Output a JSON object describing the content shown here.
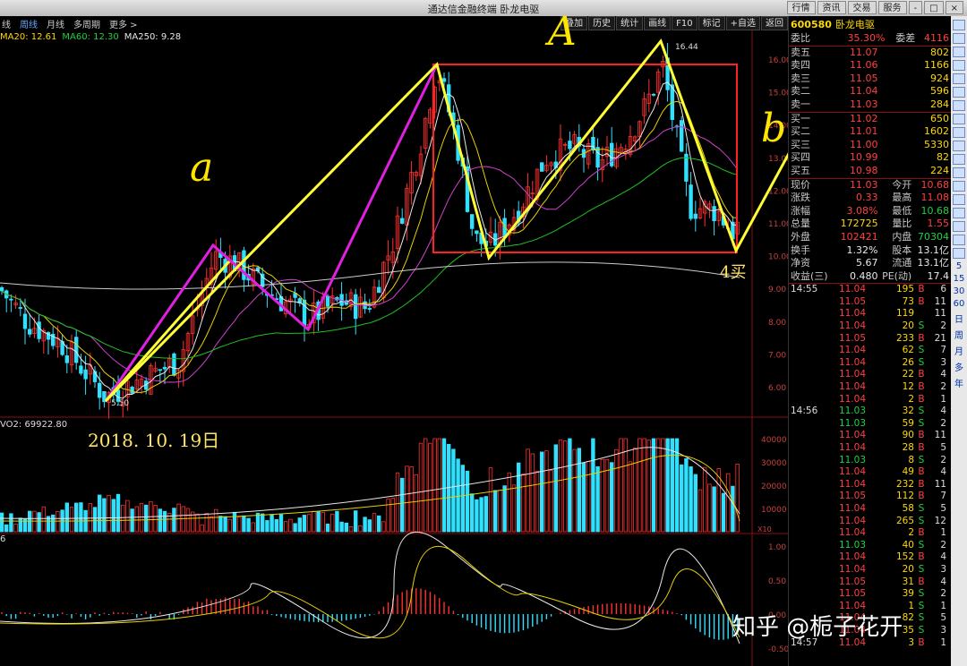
{
  "window": {
    "title": "通达信金融终端  卧龙电驱",
    "buttons": [
      "行情",
      "资讯",
      "交易",
      "服务",
      "-",
      "□",
      "×"
    ]
  },
  "tabs": {
    "left": [
      "线",
      "周线",
      "月线",
      "多周期",
      "更多 >"
    ],
    "active_index": 1,
    "right": [
      "叠加",
      "历史",
      "统计",
      "画线",
      "F10",
      "标记",
      "+自选",
      "返回"
    ]
  },
  "indicators": {
    "ma20": "MA20: 12.61",
    "ma60": "MA60: 12.30",
    "ma250": "MA250: 9.28",
    "volume": "VO2: 69922.80",
    "macd": "6"
  },
  "price_axis": [
    "16.00",
    "15.00",
    "14.00",
    "13.00",
    "12.00",
    "11.00",
    "10.00",
    "9.00",
    "8.00",
    "7.00",
    "6.00"
  ],
  "volume_axis": [
    "40000",
    "30000",
    "20000",
    "10000",
    "X10"
  ],
  "macd_axis": [
    "1.00",
    "0.50",
    "0.00",
    "-0.50"
  ],
  "price_marks": {
    "high": "16.44",
    "low": "5.50"
  },
  "annotations": {
    "date": "2018. 10. 19日",
    "wave_a": "a",
    "wave_A": "A",
    "wave_b": "b",
    "buy_note": "4买"
  },
  "watermark": "知乎 @栀子花开",
  "quote": {
    "code": "600580",
    "name": "卧龙电驱",
    "ratio": {
      "label": "委比",
      "value": "35.30%",
      "label2": "委差",
      "value2": "4116"
    },
    "asks": [
      {
        "label": "卖五",
        "price": "11.07",
        "vol": "802"
      },
      {
        "label": "卖四",
        "price": "11.06",
        "vol": "1166"
      },
      {
        "label": "卖三",
        "price": "11.05",
        "vol": "924"
      },
      {
        "label": "卖二",
        "price": "11.04",
        "vol": "596"
      },
      {
        "label": "卖一",
        "price": "11.03",
        "vol": "284"
      }
    ],
    "bids": [
      {
        "label": "买一",
        "price": "11.02",
        "vol": "650"
      },
      {
        "label": "买二",
        "price": "11.01",
        "vol": "1602"
      },
      {
        "label": "买三",
        "price": "11.00",
        "vol": "5330"
      },
      {
        "label": "买四",
        "price": "10.99",
        "vol": "82"
      },
      {
        "label": "买五",
        "price": "10.98",
        "vol": "224"
      }
    ],
    "stats": [
      {
        "l1": "现价",
        "v1": "11.03",
        "l2": "今开",
        "v2": "10.68"
      },
      {
        "l1": "涨跌",
        "v1": "0.33",
        "l2": "最高",
        "v2": "11.08"
      },
      {
        "l1": "涨幅",
        "v1": "3.08%",
        "l2": "最低",
        "v2": "10.68"
      },
      {
        "l1": "总量",
        "v1": "172725",
        "l2": "量比",
        "v2": "1.55"
      },
      {
        "l1": "外盘",
        "v1": "102421",
        "l2": "内盘",
        "v2": "70304"
      },
      {
        "l1": "换手",
        "v1": "1.32%",
        "l2": "股本",
        "v2": "13.1亿"
      },
      {
        "l1": "净资",
        "v1": "5.67",
        "l2": "流通",
        "v2": "13.1亿"
      },
      {
        "l1": "收益(三)",
        "v1": "0.480",
        "l2": "PE(动)",
        "v2": "17.4"
      }
    ],
    "ticks": [
      {
        "t": "14:55",
        "p": "11.04",
        "v": "195",
        "d": "B",
        "n": "6"
      },
      {
        "t": "",
        "p": "11.05",
        "v": "73",
        "d": "B",
        "n": "11"
      },
      {
        "t": "",
        "p": "11.04",
        "v": "119",
        "d": "",
        "n": "11"
      },
      {
        "t": "",
        "p": "11.04",
        "v": "20",
        "d": "S",
        "n": "2"
      },
      {
        "t": "",
        "p": "11.05",
        "v": "233",
        "d": "B",
        "n": "21"
      },
      {
        "t": "",
        "p": "11.04",
        "v": "62",
        "d": "S",
        "n": "7"
      },
      {
        "t": "",
        "p": "11.04",
        "v": "26",
        "d": "S",
        "n": "3"
      },
      {
        "t": "",
        "p": "11.04",
        "v": "22",
        "d": "B",
        "n": "4"
      },
      {
        "t": "",
        "p": "11.04",
        "v": "12",
        "d": "B",
        "n": "2"
      },
      {
        "t": "",
        "p": "11.04",
        "v": "2",
        "d": "B",
        "n": "1"
      },
      {
        "t": "14:56",
        "p": "11.03",
        "v": "32",
        "d": "S",
        "n": "4"
      },
      {
        "t": "",
        "p": "11.03",
        "v": "59",
        "d": "S",
        "n": "2"
      },
      {
        "t": "",
        "p": "11.04",
        "v": "90",
        "d": "B",
        "n": "11"
      },
      {
        "t": "",
        "p": "11.04",
        "v": "28",
        "d": "B",
        "n": "5"
      },
      {
        "t": "",
        "p": "11.03",
        "v": "8",
        "d": "S",
        "n": "2"
      },
      {
        "t": "",
        "p": "11.04",
        "v": "49",
        "d": "B",
        "n": "4"
      },
      {
        "t": "",
        "p": "11.04",
        "v": "232",
        "d": "B",
        "n": "11"
      },
      {
        "t": "",
        "p": "11.05",
        "v": "112",
        "d": "B",
        "n": "7"
      },
      {
        "t": "",
        "p": "11.04",
        "v": "58",
        "d": "S",
        "n": "5"
      },
      {
        "t": "",
        "p": "11.04",
        "v": "265",
        "d": "S",
        "n": "12"
      },
      {
        "t": "",
        "p": "11.04",
        "v": "2",
        "d": "B",
        "n": "1"
      },
      {
        "t": "",
        "p": "11.03",
        "v": "40",
        "d": "S",
        "n": "2"
      },
      {
        "t": "",
        "p": "11.04",
        "v": "152",
        "d": "B",
        "n": "4"
      },
      {
        "t": "",
        "p": "11.04",
        "v": "20",
        "d": "S",
        "n": "3"
      },
      {
        "t": "",
        "p": "11.05",
        "v": "31",
        "d": "B",
        "n": "4"
      },
      {
        "t": "",
        "p": "11.05",
        "v": "39",
        "d": "S",
        "n": "2"
      },
      {
        "t": "",
        "p": "11.04",
        "v": "1",
        "d": "S",
        "n": "1"
      },
      {
        "t": "",
        "p": "11.04",
        "v": "82",
        "d": "S",
        "n": "5"
      },
      {
        "t": "",
        "p": "11.04",
        "v": "35",
        "d": "S",
        "n": "3"
      },
      {
        "t": "14:57",
        "p": "11.04",
        "v": "3",
        "d": "B",
        "n": "1"
      }
    ]
  },
  "sidetools": [
    "5",
    "15",
    "30",
    "60",
    "日",
    "周",
    "月",
    "多",
    "年"
  ],
  "colors": {
    "up": "#ff3030",
    "down": "#30e0ff",
    "ma_white": "#e8e8e8",
    "ma_yellow": "#e8d000",
    "ma_purple": "#d040d0",
    "ma_green": "#20c020",
    "wave_yellow": "#ffff33",
    "wave_magenta": "#e020e0",
    "box_red": "#ff2020"
  }
}
